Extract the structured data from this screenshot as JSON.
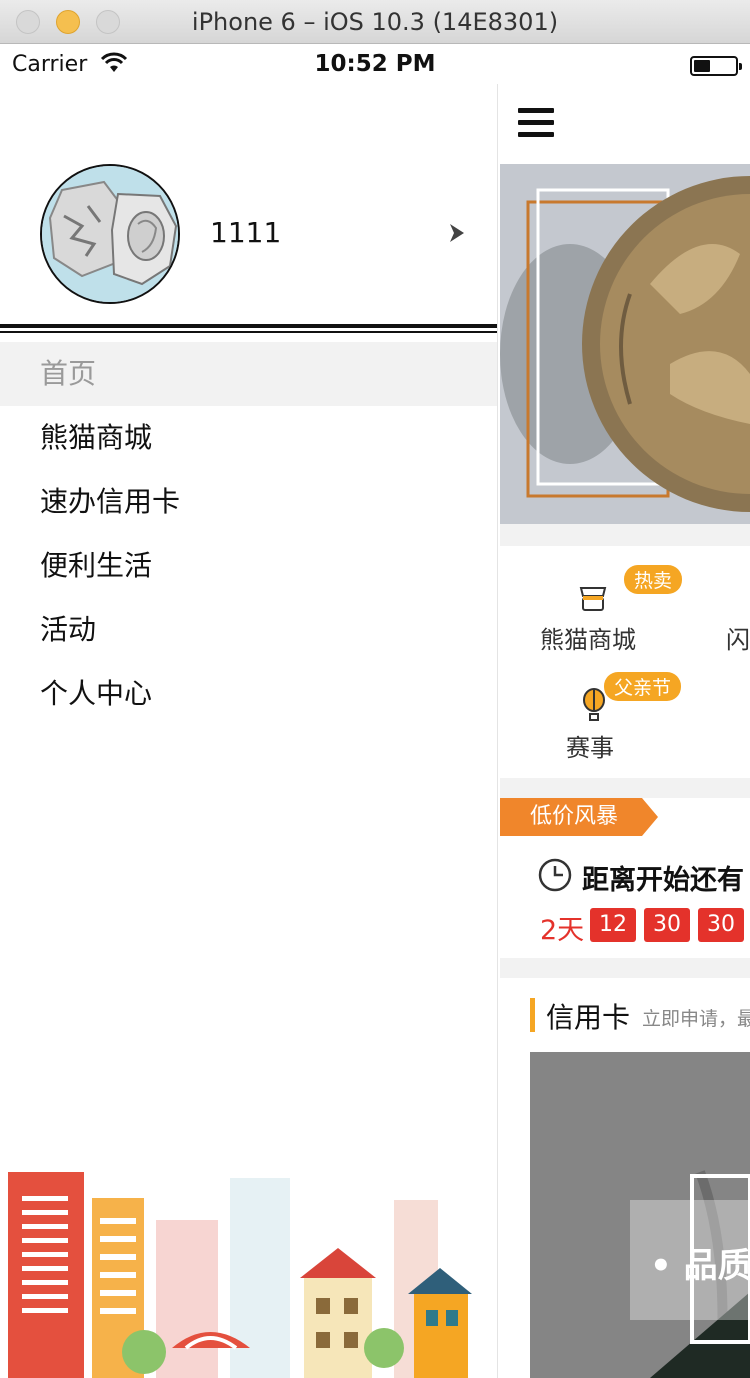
{
  "window": {
    "title": "iPhone 6 – iOS 10.3 (14E8301)"
  },
  "status_bar": {
    "carrier": "Carrier",
    "time": "10:52 PM"
  },
  "drawer": {
    "username": "1111",
    "menu": [
      {
        "label": "首页",
        "active": true
      },
      {
        "label": "熊猫商城",
        "active": false
      },
      {
        "label": "速办信用卡",
        "active": false
      },
      {
        "label": "便利生活",
        "active": false
      },
      {
        "label": "活动",
        "active": false
      },
      {
        "label": "个人中心",
        "active": false
      }
    ]
  },
  "main": {
    "categories": [
      {
        "label": "熊猫商城",
        "badge": "热卖",
        "icon": "shop-icon"
      },
      {
        "label": "闪",
        "icon": ""
      },
      {
        "label": "赛事",
        "badge": "父亲节",
        "icon": "balloon-icon"
      }
    ],
    "flash_sale": {
      "tag": "低价风暴",
      "countdown_title": "距离开始还有",
      "days": "2天",
      "hours": "12",
      "minutes": "30",
      "seconds": "30"
    },
    "credit": {
      "title": "信用卡",
      "subtitle": "立即申请，最",
      "banner_text": "• 品质"
    },
    "colors": {
      "accent": "#f5a623",
      "flash": "#f0862b",
      "timer": "#e4322b"
    }
  }
}
